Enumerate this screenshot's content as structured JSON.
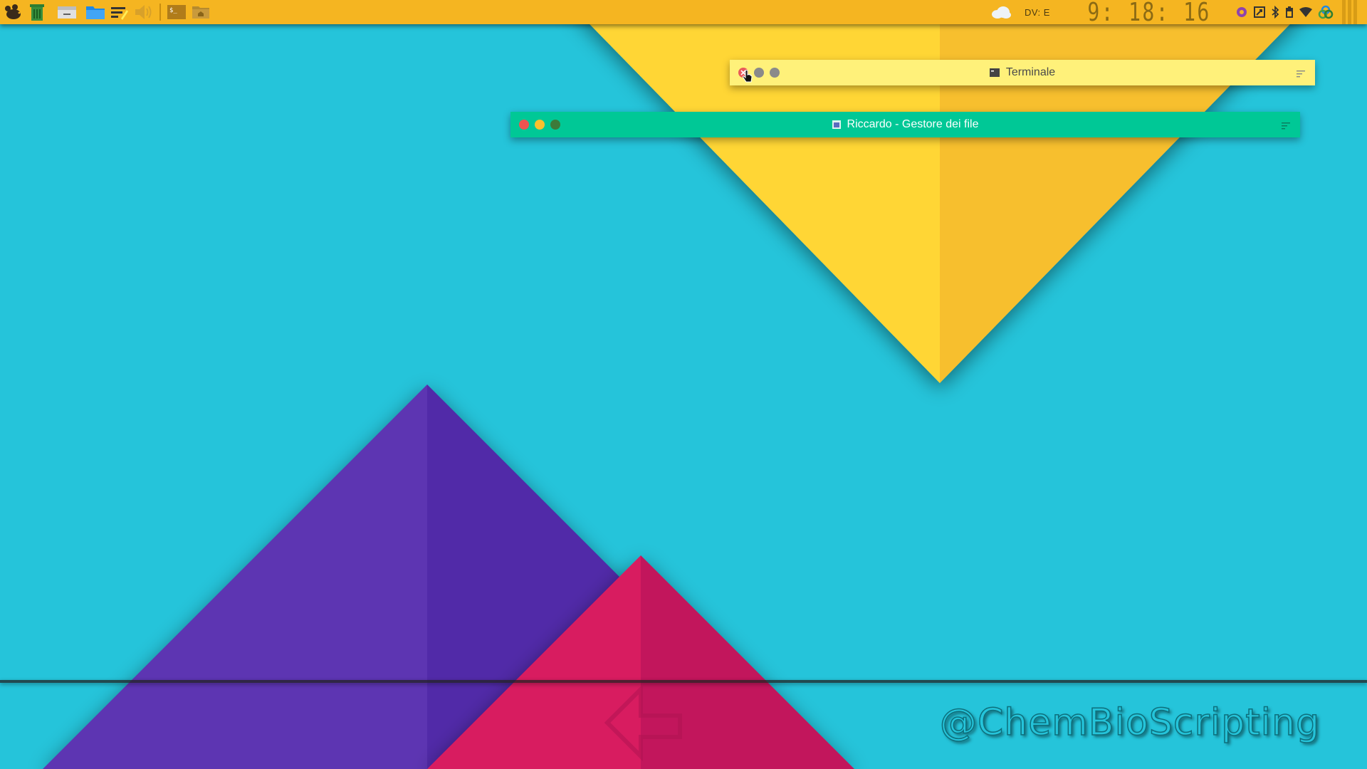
{
  "desktop": {
    "background_color": "#25c4da",
    "watermark": "@ChemBioScripting"
  },
  "panel": {
    "background_color": "#f5b521",
    "launchers": [
      {
        "icon": "mouse-app-menu-icon"
      },
      {
        "icon": "trash-icon"
      },
      {
        "icon": "drive-icon"
      },
      {
        "icon": "folder-icon"
      },
      {
        "icon": "text-editor-icon"
      },
      {
        "icon": "volume-icon"
      },
      {
        "icon": "terminal-icon"
      },
      {
        "icon": "home-folder-icon"
      }
    ],
    "tray": {
      "weather_icon": "cloud-icon",
      "keyboard_layout": "DV: E",
      "clock": "9: 18: 16",
      "status_icons": [
        "settings-flower-icon",
        "screenshot-icon",
        "bluetooth-icon",
        "battery-icon",
        "wifi-icon",
        "network-icon"
      ]
    }
  },
  "windows": [
    {
      "id": "terminal",
      "title": "Terminale",
      "titlebar_color": "#fff17a",
      "icon": "terminal-icon",
      "buttons": [
        "close-button",
        "minimize-button",
        "maximize-button"
      ]
    },
    {
      "id": "files",
      "title": "Riccardo - Gestore dei file",
      "titlebar_color": "#00c896",
      "icon": "file-manager-icon",
      "buttons": [
        "close-button",
        "minimize-button",
        "maximize-button"
      ]
    }
  ]
}
